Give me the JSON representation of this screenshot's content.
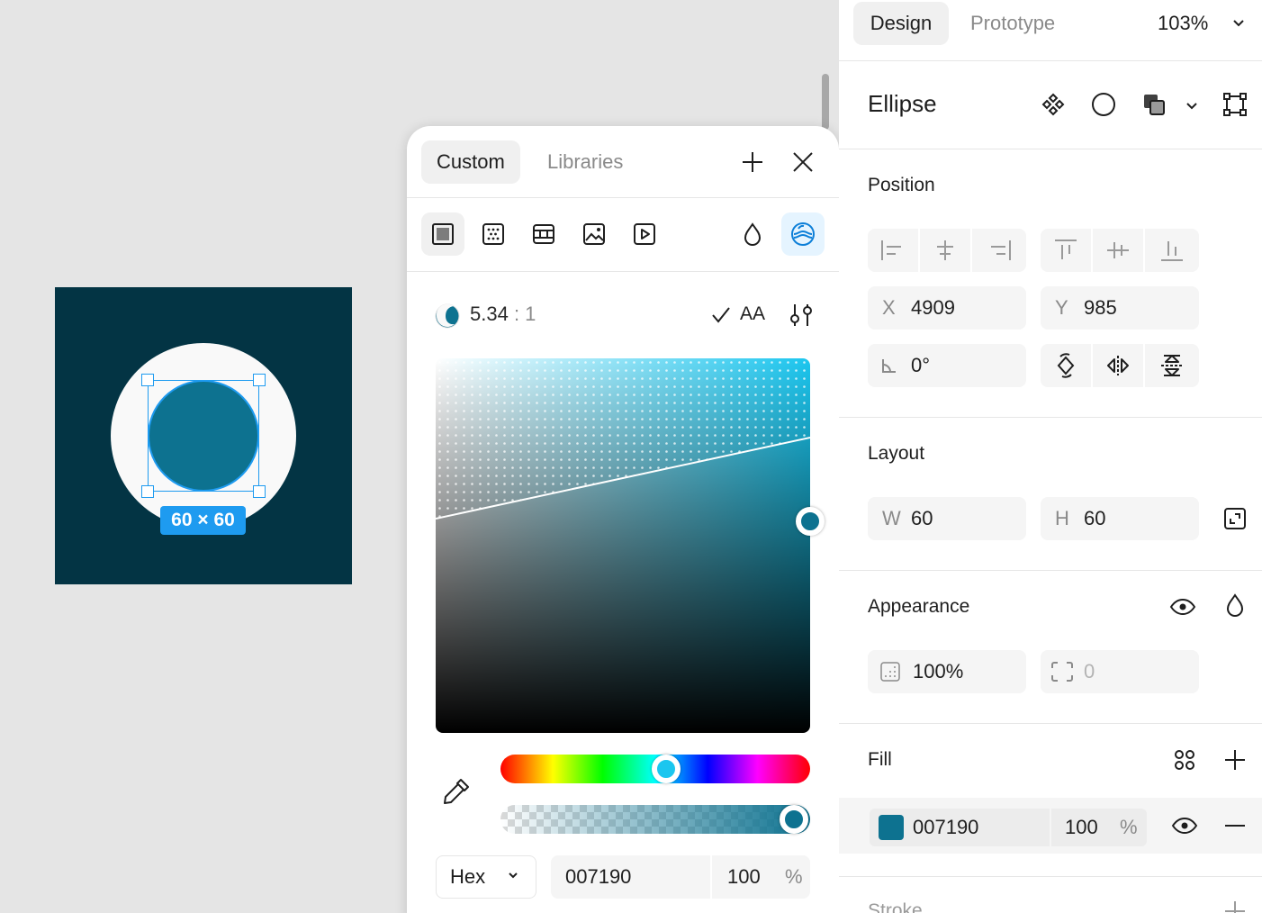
{
  "canvas": {
    "size_badge": "60 × 60",
    "colors": {
      "frame": "#033444",
      "circle": "#f9f9f9",
      "ellipse": "#0d7290",
      "selection": "#1e9bf0"
    }
  },
  "picker": {
    "tabs": [
      "Custom",
      "Libraries"
    ],
    "active_tab": "Custom",
    "icons": {
      "add": "plus-icon",
      "close": "close-icon",
      "types": [
        "solid-fill-icon",
        "gradient-fill-icon",
        "pattern-fill-icon",
        "image-fill-icon",
        "video-fill-icon"
      ],
      "opacity": "droplet-icon",
      "contrast": "contrast-check-icon"
    },
    "contrast": {
      "ratio": "5.34",
      "unit": ": 1",
      "level": "AA"
    },
    "color": {
      "hex": "007190",
      "opacity": "100",
      "percent": "%",
      "format": "Hex",
      "swatch": "#0d7290",
      "hue": "#1bc6ef"
    }
  },
  "panel": {
    "tabs": {
      "design": "Design",
      "prototype": "Prototype"
    },
    "zoom": "103%",
    "layer_name": "Ellipse",
    "position": {
      "title": "Position",
      "x_label": "X",
      "x": "4909",
      "y_label": "Y",
      "y": "985",
      "rotation": "0°"
    },
    "layout": {
      "title": "Layout",
      "w_label": "W",
      "w": "60",
      "h_label": "H",
      "h": "60"
    },
    "appearance": {
      "title": "Appearance",
      "opacity": "100%",
      "radius": "0"
    },
    "fill": {
      "title": "Fill",
      "hex": "007190",
      "opacity": "100",
      "percent": "%",
      "swatch": "#0d7290"
    },
    "stroke": {
      "title": "Stroke"
    }
  }
}
